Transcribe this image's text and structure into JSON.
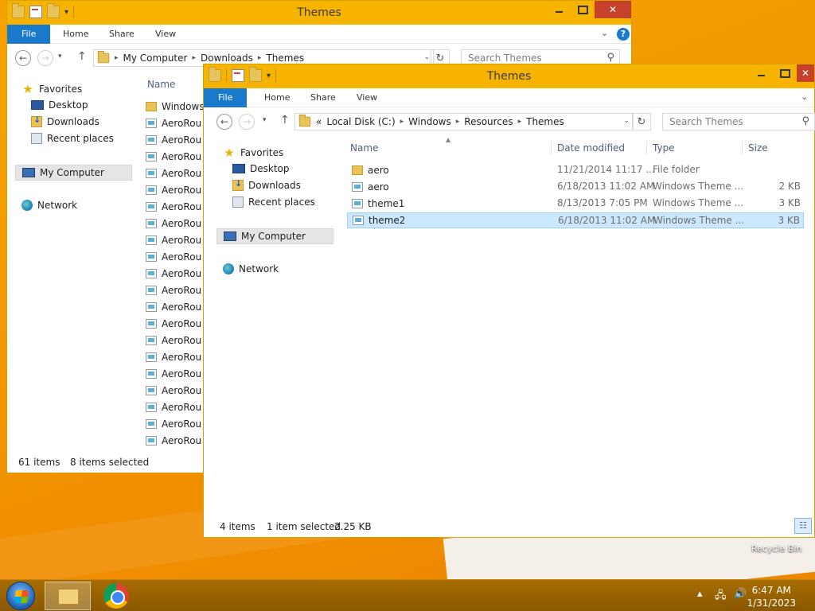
{
  "desktop": {
    "recycle_bin": "Recycle Bin"
  },
  "back_window": {
    "title": "Themes",
    "ribbon": {
      "file": "File",
      "home": "Home",
      "share": "Share",
      "view": "View"
    },
    "address": [
      "My Computer",
      "Downloads",
      "Themes"
    ],
    "search_placeholder": "Search Themes",
    "nav": {
      "favorites": "Favorites",
      "desktop": "Desktop",
      "downloads": "Downloads",
      "recent": "Recent places",
      "computer": "My Computer",
      "network": "Network"
    },
    "column_name": "Name",
    "files": [
      "Windows",
      "AeroRou",
      "AeroRou",
      "AeroRou",
      "AeroRou",
      "AeroRou",
      "AeroRou",
      "AeroRou",
      "AeroRou",
      "AeroRou",
      "AeroRou",
      "AeroRou",
      "AeroRou",
      "AeroRou",
      "AeroRou",
      "AeroRou",
      "AeroRou",
      "AeroRou",
      "AeroRou",
      "AeroRou",
      "AeroRou"
    ],
    "status": {
      "count": "61 items",
      "selected": "8 items selected"
    }
  },
  "front_window": {
    "title": "Themes",
    "ribbon": {
      "file": "File",
      "home": "Home",
      "share": "Share",
      "view": "View"
    },
    "address_prefix": "«",
    "address": [
      "Local Disk (C:)",
      "Windows",
      "Resources",
      "Themes"
    ],
    "search_placeholder": "Search Themes",
    "nav": {
      "favorites": "Favorites",
      "desktop": "Desktop",
      "downloads": "Downloads",
      "recent": "Recent places",
      "computer": "My Computer",
      "network": "Network"
    },
    "columns": {
      "name": "Name",
      "date": "Date modified",
      "type": "Type",
      "size": "Size"
    },
    "files": [
      {
        "name": "aero",
        "date": "11/21/2014 11:17 ...",
        "type": "File folder",
        "size": "",
        "kind": "folder"
      },
      {
        "name": "aero",
        "date": "6/18/2013 11:02 AM",
        "type": "Windows Theme ...",
        "size": "2 KB",
        "kind": "file"
      },
      {
        "name": "theme1",
        "date": "8/13/2013 7:05 PM",
        "type": "Windows Theme ...",
        "size": "3 KB",
        "kind": "file"
      },
      {
        "name": "theme2",
        "date": "6/18/2013 11:02 AM",
        "type": "Windows Theme ...",
        "size": "3 KB",
        "kind": "file"
      }
    ],
    "status": {
      "count": "4 items",
      "selected": "1 item selected",
      "size": "2.25 KB"
    }
  },
  "taskbar": {
    "time": "6:47 AM",
    "date": "1/31/2023"
  }
}
